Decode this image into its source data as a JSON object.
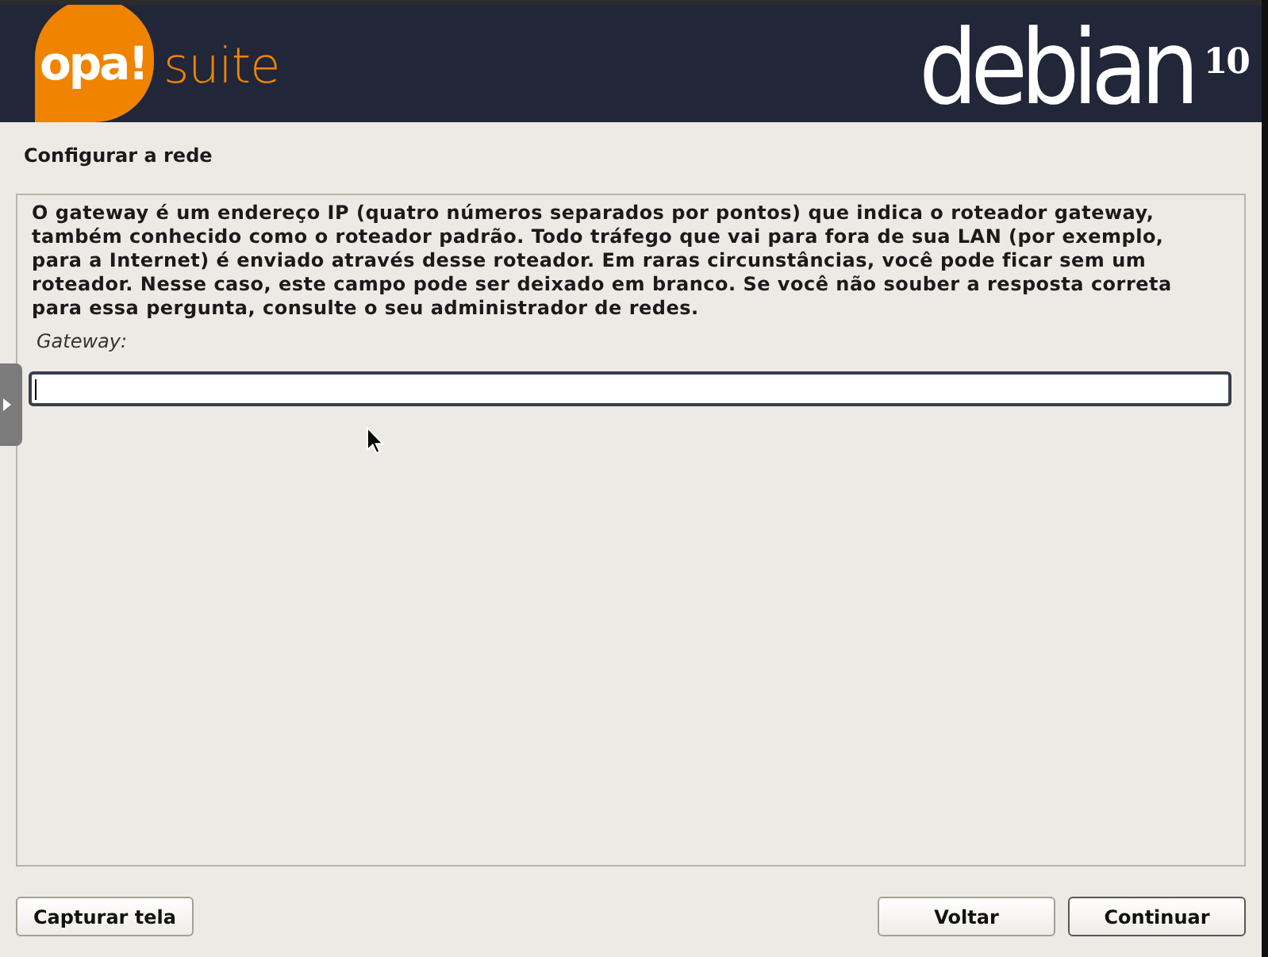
{
  "header": {
    "left_logo": {
      "mark": "opa!",
      "word": "suite"
    },
    "right_logo": {
      "word": "debian",
      "version": "10"
    }
  },
  "page_title": "Configurar a rede",
  "question": {
    "description": "O gateway é um endereço IP (quatro números separados por pontos) que indica o roteador gateway, também conhecido como o roteador padrão. Todo tráfego que vai para fora de sua LAN (por exemplo, para a Internet) é enviado através desse roteador. Em raras circunstâncias, você pode ficar sem um roteador. Nesse caso, este campo pode ser deixado em branco. Se você não souber a resposta correta para essa pergunta, consulte o seu administrador de redes.",
    "field_label": "Gateway:",
    "field_focused": true
  },
  "footer": {
    "left_buttons": [
      {
        "label": "Capturar tela",
        "default": false
      }
    ],
    "right_buttons": [
      {
        "label": "Voltar",
        "default": false
      },
      {
        "label": "Continuar",
        "default": true
      }
    ]
  }
}
